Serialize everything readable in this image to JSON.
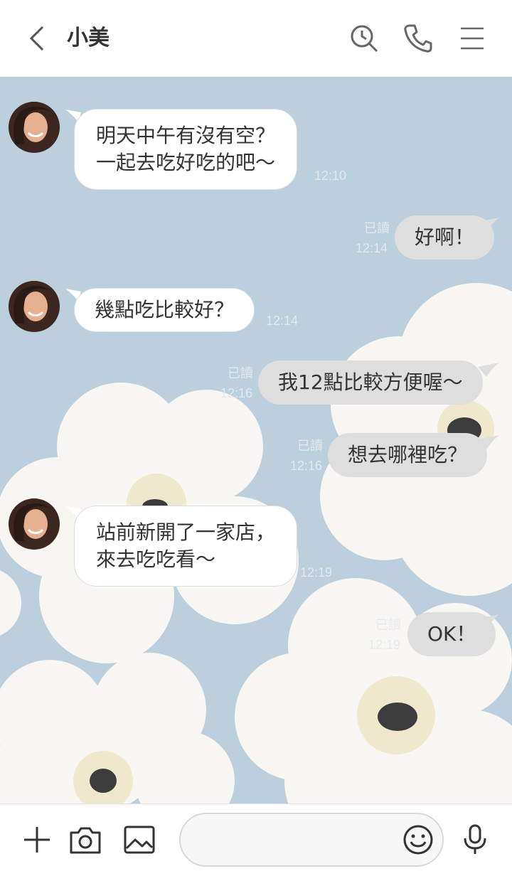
{
  "header": {
    "title": "小美",
    "icons": [
      "back-arrow-icon",
      "search-history-icon",
      "phone-icon",
      "menu-icon"
    ]
  },
  "messages": [
    {
      "side": "incoming",
      "lines": [
        "明天中午有沒有空？",
        "一起去吃好吃的吧～"
      ],
      "time": "12:10"
    },
    {
      "side": "outgoing",
      "lines": [
        "好啊！"
      ],
      "read": "已讀",
      "time": "12:14"
    },
    {
      "side": "incoming",
      "lines": [
        "幾點吃比較好？"
      ],
      "time": "12:14"
    },
    {
      "side": "outgoing",
      "lines": [
        "我12點比較方便喔～"
      ],
      "read": "已讀",
      "time": "12:16"
    },
    {
      "side": "outgoing",
      "lines": [
        "想去哪裡吃？"
      ],
      "read": "已讀",
      "time": "12:16"
    },
    {
      "side": "incoming",
      "lines": [
        "站前新開了一家店，",
        "來去吃吃看～"
      ],
      "time": "12:19"
    },
    {
      "side": "outgoing",
      "lines": [
        "OK！"
      ],
      "read": "已讀",
      "time": "12:19"
    }
  ],
  "input_bar": {
    "placeholder": "",
    "icons": [
      "plus-icon",
      "camera-icon",
      "image-icon",
      "emoji-icon",
      "microphone-icon"
    ]
  },
  "colors": {
    "chat_background": "#bccfdc",
    "incoming_bubble": "#ffffff",
    "outgoing_bubble": "#dedede",
    "flower": "#f8f6f3",
    "flower_center": "#efe8cc",
    "flower_dot": "#3c3c3c"
  }
}
